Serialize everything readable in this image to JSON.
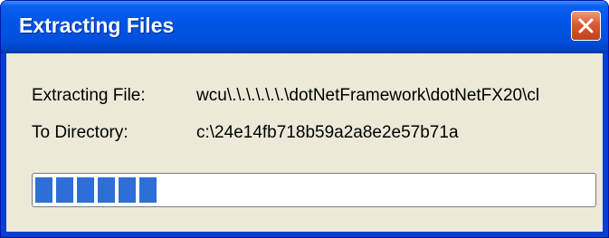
{
  "window": {
    "title": "Extracting Files",
    "close_icon": "close-x-icon"
  },
  "fields": {
    "extracting_label": "Extracting File:",
    "extracting_value": "wcu\\.\\.\\.\\.\\.\\.\\dotNetFramework\\dotNetFX20\\cl",
    "directory_label": "To Directory:",
    "directory_value": "c:\\24e14fb718b59a2a8e2e57b71a"
  },
  "progress": {
    "segments_filled": 6,
    "percent": 23
  },
  "colors": {
    "titlebar": "#0055e6",
    "client_bg": "#ece9d8",
    "progress_fill": "#2d6fd6",
    "close_button": "#d85a37"
  }
}
